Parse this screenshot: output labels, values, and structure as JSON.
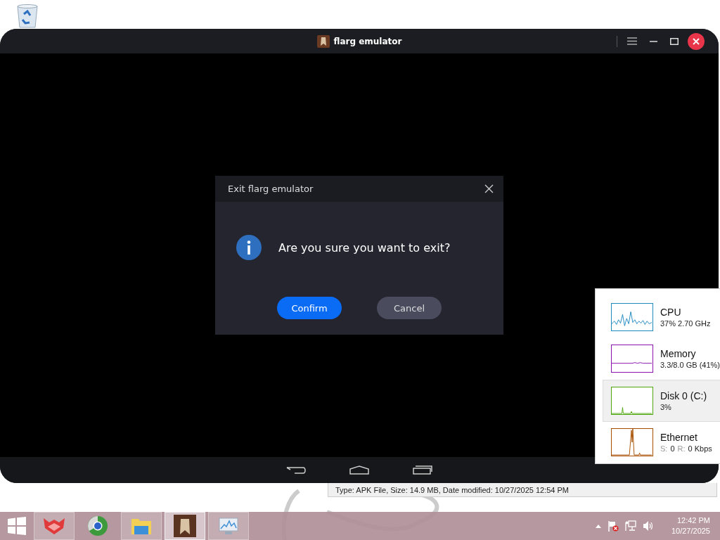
{
  "emulator_window": {
    "title": "flarg emulator",
    "dialog": {
      "title": "Exit flarg emulator",
      "message": "Are you sure you want to exit?",
      "buttons": [
        {
          "label": "Confirm",
          "kind": "primary"
        },
        {
          "label": "Cancel",
          "kind": "secondary"
        }
      ]
    }
  },
  "performance_panel": {
    "items": [
      {
        "name": "CPU",
        "kind": "cpu",
        "color": "#1f8ac0",
        "selected": false,
        "detail": [
          {
            "text": "37% 2.70 GHz",
            "muted": false
          }
        ]
      },
      {
        "name": "Memory",
        "kind": "memory",
        "color": "#8b12ae",
        "selected": false,
        "detail": [
          {
            "text": "3.3/8.0 GB (41%)",
            "muted": false
          }
        ]
      },
      {
        "name": "Disk 0 (C:)",
        "kind": "disk",
        "color": "#4da60c",
        "selected": true,
        "detail": [
          {
            "text": "3%",
            "muted": false
          }
        ]
      },
      {
        "name": "Ethernet",
        "kind": "ethernet",
        "color": "#a74f01",
        "selected": false,
        "detail": [
          {
            "text": "S:",
            "muted": true
          },
          {
            "text": "0",
            "muted": false
          },
          {
            "text": "R:",
            "muted": true
          },
          {
            "text": "0 Kbps",
            "muted": false
          }
        ]
      }
    ]
  },
  "file_status": "Type: APK File, Size: 14.9 MB, Date modified: 10/27/2025 12:54 PM",
  "taskbar": {
    "apps": [
      {
        "kind": "fox",
        "running": true,
        "selected": false
      },
      {
        "kind": "browser",
        "running": false,
        "selected": false
      },
      {
        "kind": "folder",
        "running": true,
        "selected": false
      },
      {
        "kind": "emulator",
        "running": true,
        "selected": true
      },
      {
        "kind": "monitor",
        "running": true,
        "selected": false
      }
    ],
    "clock": {
      "time": "12:42 PM",
      "date": "10/27/2025"
    }
  }
}
